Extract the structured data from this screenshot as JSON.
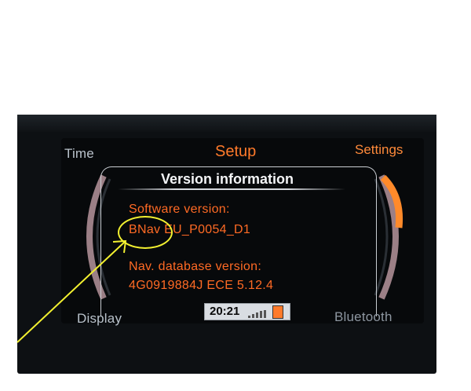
{
  "nav": {
    "time_label": "Time",
    "setup_label": "Setup",
    "settings_label": "Settings",
    "display_label": "Display",
    "bluetooth_label": "Bluetooth"
  },
  "dialog": {
    "title": "Version information",
    "software_label": "Software version:",
    "software_value": "BNav EU_P0054_D1",
    "database_label": "Nav. database version:",
    "database_value": "4G0919884J ECE 5.12.4"
  },
  "status": {
    "time": "20:21"
  },
  "colors": {
    "accent_orange": "#ff6a24",
    "annotation_yellow": "#f2f030"
  }
}
